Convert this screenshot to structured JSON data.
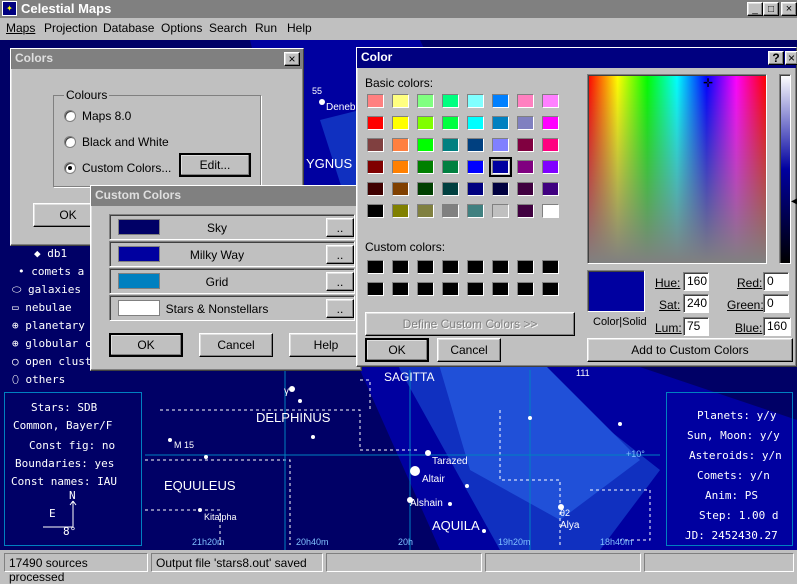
{
  "app": {
    "title": "Celestial Maps",
    "menu": [
      "Maps",
      "Projection",
      "Database",
      "Options",
      "Search",
      "Run",
      "Help"
    ],
    "window_controls": [
      "_",
      "□",
      "×"
    ]
  },
  "map": {
    "left_panel": {
      "objects": [
        "db1",
        "comets",
        "galaxies",
        "nebulae",
        "planetary n",
        "globular cl",
        "open clust",
        "others"
      ],
      "objects_extra": "a",
      "info": [
        "Stars: SDB",
        "Common, Bayer/F",
        "Const fig: no",
        "Boundaries: yes",
        "Const names: IAU"
      ],
      "compass_n": "N",
      "compass_e": "E",
      "scale": "8°"
    },
    "right_panel": {
      "info": [
        "Planets: y/y",
        "Sun, Moon: y/y",
        "Asteroids: y/n",
        "Comets: y/n",
        "Anim: PS",
        "Step: 1.00 d",
        "JD: 2452430.27"
      ]
    },
    "labels": {
      "cygnus": "YGNUS",
      "deneb": "Deneb",
      "deneb_num": "55",
      "delphinus": "DELPHINUS",
      "equuleus": "EQUULEUS",
      "kitalpha": "Kitalpha",
      "aquila": "AQUILA",
      "sagitta": "SAGITTA",
      "tarazed": "Tarazed",
      "altair": "Altair",
      "alshain": "Alshain",
      "alya": "Alya",
      "m15": "M 15",
      "alya_num": "θ2",
      "ra_labels": [
        "21h20m",
        "20h40m",
        "20h",
        "19h20m",
        "18h40m"
      ],
      "dec_label": "+10°",
      "num_111": "111",
      "num_72": "γ"
    }
  },
  "colors_dialog": {
    "title": "Colors",
    "group_label": "Colours",
    "options": [
      "Maps 8.0",
      "Black and White",
      "Custom Colors..."
    ],
    "selected": 2,
    "edit_label": "Edit...",
    "ok_label": "OK"
  },
  "custom_colors_dialog": {
    "title": "Custom Colors",
    "rows": [
      {
        "label": "Sky",
        "color": "#000066",
        "button": ".."
      },
      {
        "label": "Milky Way",
        "color": "#0000a0",
        "button": ".."
      },
      {
        "label": "Grid",
        "color": "#0080c0",
        "button": ".."
      },
      {
        "label": "Stars & Nonstellars",
        "color": "#ffffff",
        "button": ".."
      }
    ],
    "ok_label": "OK",
    "cancel_label": "Cancel",
    "help_label": "Help"
  },
  "color_dialog": {
    "title": "Color",
    "help_btn": "?",
    "close_btn": "×",
    "basic_label": "Basic colors:",
    "basic_colors": [
      "#ff8080",
      "#ffff80",
      "#80ff80",
      "#00ff80",
      "#80ffff",
      "#0080ff",
      "#ff80c0",
      "#ff80ff",
      "#ff0000",
      "#ffff00",
      "#80ff00",
      "#00ff40",
      "#00ffff",
      "#0080c0",
      "#8080c0",
      "#ff00ff",
      "#804040",
      "#ff8040",
      "#00ff00",
      "#008080",
      "#004080",
      "#8080ff",
      "#800040",
      "#ff0080",
      "#800000",
      "#ff8000",
      "#008000",
      "#008040",
      "#0000ff",
      "#0000a0",
      "#800080",
      "#8000ff",
      "#400000",
      "#804000",
      "#004000",
      "#004040",
      "#000080",
      "#000040",
      "#400040",
      "#400080",
      "#000000",
      "#808000",
      "#808040",
      "#808080",
      "#408080",
      "#c0c0c0",
      "#400040",
      "#ffffff"
    ],
    "selected_basic": 29,
    "custom_label": "Custom colors:",
    "define_label": "Define Custom Colors >>",
    "ok_label": "OK",
    "cancel_label": "Cancel",
    "preview_label": "Color|Solid",
    "preview_color": "#0000a0",
    "hue_label": "Hue:",
    "hue": "160",
    "sat_label": "Sat:",
    "sat": "240",
    "lum_label": "Lum:",
    "lum": "75",
    "red_label": "Red:",
    "red": "0",
    "green_label": "Green:",
    "green": "0",
    "blue_label": "Blue:",
    "blue": "160",
    "add_label": "Add to Custom Colors"
  },
  "status": {
    "left": "17490 sources processed",
    "right": "Output file 'stars8.out' saved"
  }
}
